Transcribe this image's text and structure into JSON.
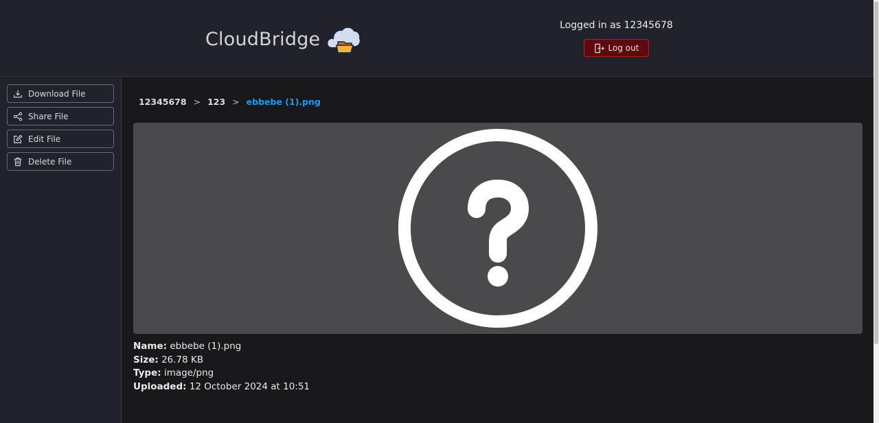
{
  "header": {
    "app_name": "CloudBridge",
    "logged_in_text": "Logged in as 12345678",
    "logout_label": "Log out"
  },
  "sidebar": {
    "items": [
      {
        "label": "Download File",
        "icon": "download-icon"
      },
      {
        "label": "Share File",
        "icon": "share-icon"
      },
      {
        "label": "Edit File",
        "icon": "edit-icon"
      },
      {
        "label": "Delete File",
        "icon": "trash-icon"
      }
    ]
  },
  "breadcrumb": {
    "items": [
      "12345678",
      "123"
    ],
    "separator": ">",
    "current": "ebbebe (1).png"
  },
  "preview": {
    "icon": "question-circle-icon"
  },
  "file_info": {
    "name_label": "Name:",
    "name": "ebbebe (1).png",
    "size_label": "Size:",
    "size": "26.78 KB",
    "type_label": "Type:",
    "type": "image/png",
    "uploaded_label": "Uploaded:",
    "uploaded": "12 October 2024 at 10:51"
  },
  "colors": {
    "header_bg": "#22222b",
    "content_bg": "#18181b",
    "accent": "#1e9bf0",
    "logout_bg": "#5c0a0d",
    "logout_border": "#b81e24"
  }
}
